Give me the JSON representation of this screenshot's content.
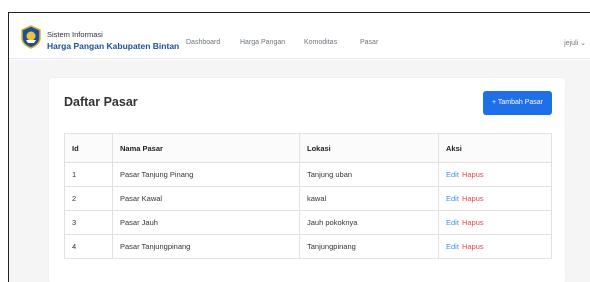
{
  "navbar": {
    "brand_sub": "Sistem Informasi",
    "brand_title": "Harga Pangan Kabupaten Bintan",
    "links": [
      "Dashboard",
      "Harga Pangan",
      "Komoditas",
      "Pasar"
    ],
    "user": "jejuli ⌄",
    "icon": "logo-emblem"
  },
  "main": {
    "title": "Daftar Pasar",
    "add_button": "+ Tambah Pasar",
    "accent_color": "#1e6fe8"
  },
  "table": {
    "headers": [
      "Id",
      "Nama Pasar",
      "Lokasi",
      "Aksi"
    ],
    "rows": [
      {
        "id": "1",
        "nama": "Pasar Tanjung Pinang",
        "lokasi": "Tanjung uban",
        "edit": "Edit",
        "hapus": "Hapus"
      },
      {
        "id": "2",
        "nama": "Pasar Kawal",
        "lokasi": "kawal",
        "edit": "Edit",
        "hapus": "Hapus"
      },
      {
        "id": "3",
        "nama": "Pasar Jauh",
        "lokasi": "Jauh pokoknya",
        "edit": "Edit",
        "hapus": "Hapus"
      },
      {
        "id": "4",
        "nama": "Pasar Tanjungpinang",
        "lokasi": "Tanjungpinang",
        "edit": "Edit",
        "hapus": "Hapus"
      }
    ]
  }
}
